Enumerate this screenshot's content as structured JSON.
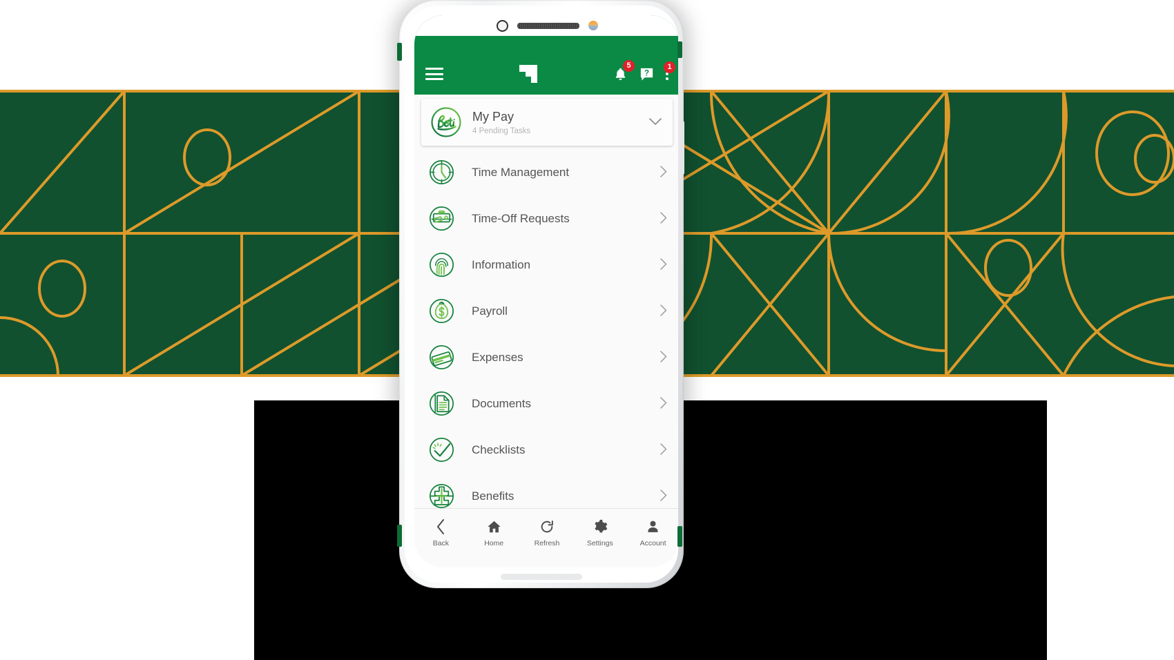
{
  "background": {
    "band_color": "#11512f",
    "line_color": "#dd9a2a",
    "panel_color": "#000000"
  },
  "phone": {
    "hardware": {
      "camera_dot": "camera-dot",
      "speaker": "earpiece-speaker",
      "front_camera": "front-camera-lens"
    }
  },
  "app": {
    "header": {
      "bg_color": "#0b8a45",
      "menu_icon": "hamburger-menu-icon",
      "logo": "paycom-logo",
      "notifications": {
        "icon": "bell-icon",
        "badge": "5"
      },
      "help": {
        "icon": "help-question-icon",
        "label": "?"
      },
      "overflow": {
        "icon": "kebab-menu-icon",
        "badge": "1"
      }
    },
    "mypay_card": {
      "logo": "beti-logo",
      "logo_text": "Beti",
      "title": "My Pay",
      "subtitle": "4 Pending Tasks",
      "expand_icon": "chevron-down-icon"
    },
    "menu": {
      "chevron_icon": "chevron-right-icon",
      "items": [
        {
          "label": "Time Management",
          "icon": "clock-icon"
        },
        {
          "label": "Time-Off Requests",
          "icon": "suitcase-icon"
        },
        {
          "label": "Information",
          "icon": "fingerprint-icon"
        },
        {
          "label": "Payroll",
          "icon": "money-bag-dollar-icon"
        },
        {
          "label": "Expenses",
          "icon": "credit-card-icon"
        },
        {
          "label": "Documents",
          "icon": "document-icon"
        },
        {
          "label": "Checklists",
          "icon": "checkmark-icon"
        },
        {
          "label": "Benefits",
          "icon": "medical-cross-icon"
        }
      ]
    },
    "bottom_nav": {
      "items": [
        {
          "label": "Back",
          "icon": "chevron-left-icon"
        },
        {
          "label": "Home",
          "icon": "home-icon"
        },
        {
          "label": "Refresh",
          "icon": "refresh-icon"
        },
        {
          "label": "Settings",
          "icon": "gear-icon"
        },
        {
          "label": "Account",
          "icon": "person-icon"
        }
      ]
    }
  }
}
